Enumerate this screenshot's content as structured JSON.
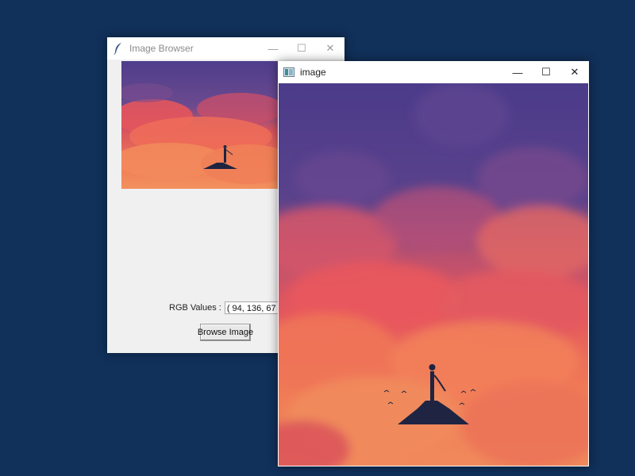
{
  "desktop": {
    "background_color": "#11305a"
  },
  "browser_window": {
    "title": "Image Browser",
    "title_icon": "feather-icon",
    "controls": {
      "minimize": "—",
      "maximize": "☐",
      "close": "✕"
    },
    "rgb_label": "RGB Values :",
    "rgb_value": "( 94, 136, 67 )",
    "browse_button_label": "Browse Image",
    "thumbnail": "sunset-cloud-figure-image"
  },
  "image_window": {
    "title": "image",
    "title_icon": "image-app-icon",
    "controls": {
      "minimize": "—",
      "maximize": "☐",
      "close": "✕"
    },
    "image": "sunset-cloud-figure-image"
  },
  "colors": {
    "sky_purple": "#4e3d8c",
    "cloud_red": "#e8545a",
    "cloud_orange": "#f2835a",
    "silhouette": "#1e2440"
  }
}
